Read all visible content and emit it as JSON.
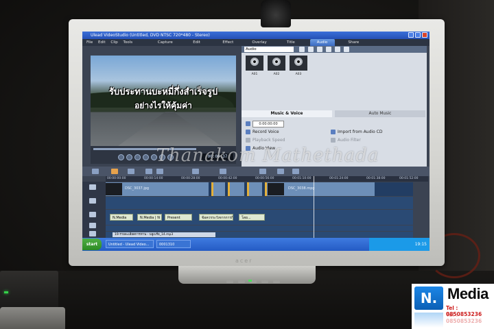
{
  "app": {
    "title": "Ulead VideoStudio (Untitled, DVD NTSC 720*480 - Stereo)",
    "menu": [
      "File",
      "Edit",
      "Clip",
      "Tools"
    ],
    "steps": [
      "Capture",
      "Edit",
      "Effect",
      "Overlay",
      "Title",
      "Audio",
      "Share"
    ],
    "active_step": "Audio"
  },
  "preview": {
    "subtitle_line1": "รับประทานบะหมี่กึ่งสำเร็จรูป",
    "subtitle_line2": "อย่างไรให้คุ้มค่า",
    "timecode": "00:00:37"
  },
  "library": {
    "category": "Audio",
    "clips": [
      "A01",
      "A02",
      "A03"
    ]
  },
  "audio_options": {
    "tab_music_voice": "Music & Voice",
    "tab_auto_music": "Auto Music",
    "duration": "0:00:00:00",
    "record_voice": "Record Voice",
    "import_cd": "Import from Audio CD",
    "playback_speed": "Playback Speed",
    "audio_filter": "Audio Filter",
    "audio_view": "Audio View"
  },
  "timeline": {
    "ruler": [
      "00:00:00:00",
      "00:00:14:00",
      "00:00:28:00",
      "00:00:42:00",
      "00:00:56:00",
      "00:01:10:00",
      "00:01:24:00",
      "00:01:38:00",
      "00:01:52:00"
    ],
    "video_clips": [
      "DSC_3037.jpg",
      "DSC_3038.mpg"
    ],
    "title_clips": [
      "N.Media",
      "N.Media | N",
      "Present",
      "ข้อควรระวังจากการกิน",
      "โดย..."
    ],
    "music_clip": "19-รายละเอียดการทาน - บลูเบร์ย_14.mp3"
  },
  "taskbar": {
    "start": "start",
    "items": [
      "Untitled - Ulead Video...",
      "0001310"
    ],
    "clock": "19:15"
  },
  "watermark": "Thanakom Mathethada",
  "logo": {
    "mark": "N.",
    "word": "Media",
    "tel": "Tel : 0850853236"
  },
  "monitor": {
    "brand": "acer"
  }
}
